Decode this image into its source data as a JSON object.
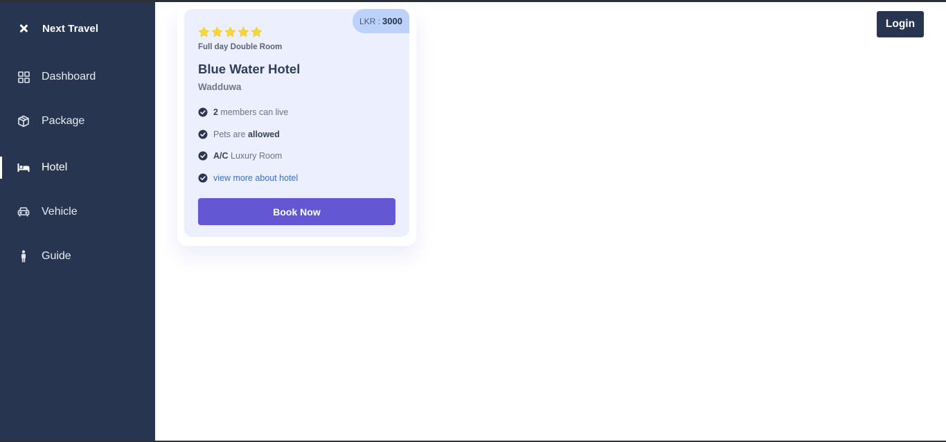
{
  "sidebar": {
    "brand": "Next Travel",
    "items": [
      {
        "label": "Dashboard",
        "icon": "dashboard-grid-icon"
      },
      {
        "label": "Package",
        "icon": "package-box-icon"
      },
      {
        "label": "Hotel",
        "icon": "bed-icon",
        "active": true
      },
      {
        "label": "Vehicle",
        "icon": "car-icon"
      },
      {
        "label": "Guide",
        "icon": "person-icon"
      }
    ]
  },
  "header": {
    "login_label": "Login"
  },
  "card": {
    "price_prefix": "LKR :",
    "price_value": "3000",
    "rating": 5,
    "room_type": "Full day Double Room",
    "hotel_name": "Blue Water Hotel",
    "location": "Wadduwa",
    "features": [
      {
        "bold": "2",
        "text": " members can live"
      },
      {
        "text": "Pets are ",
        "bold": "allowed"
      },
      {
        "bold": "A/C",
        "text": " Luxury Room"
      },
      {
        "link": "view more about hotel"
      }
    ],
    "book_label": "Book Now"
  },
  "colors": {
    "sidebar_bg": "#283550",
    "card_bg": "#eceffd",
    "badge_bg": "#bcd2fb",
    "button_accent": "#6457d3",
    "star": "#f7d733",
    "link": "#2f6fd0"
  }
}
